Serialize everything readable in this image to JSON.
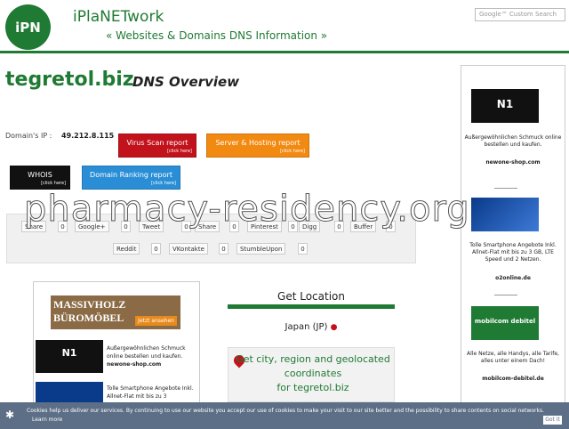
{
  "header": {
    "logo_text": "iPN",
    "brand": "iPlaNETwork",
    "tagline": "« Websites & Domains DNS Information »",
    "search_placeholder": "Google™ Custom Search"
  },
  "main": {
    "domain": "tegretol.biz",
    "subtitle": "DNS Overview",
    "ip_label": "Domain's IP :",
    "ip_value": "49.212.8.115",
    "buttons": {
      "virus": {
        "label": "Virus Scan report",
        "sub": "[click here]"
      },
      "hosting": {
        "label": "Server & Hosting report",
        "sub": "[click here]"
      },
      "whois": {
        "label": "WHOIS",
        "sub": "[click here]"
      },
      "ranking": {
        "label": "Domain Ranking report",
        "sub": "[click here]"
      }
    },
    "share": {
      "buttons": [
        {
          "label": "Share",
          "count": "0"
        },
        {
          "label": "Google+",
          "count": "0"
        },
        {
          "label": "Tweet",
          "count": "0"
        },
        {
          "label": "Share",
          "count": "0"
        },
        {
          "label": "Pinterest",
          "count": "0"
        },
        {
          "label": "Digg",
          "count": "0"
        },
        {
          "label": "Buffer",
          "count": "0"
        },
        {
          "label": "Reddit",
          "count": "0"
        },
        {
          "label": "VKontakte",
          "count": "0"
        },
        {
          "label": "StumbleUpon",
          "count": "0"
        }
      ]
    },
    "ads": {
      "massiv_line1": "MASSIVHOLZ",
      "massiv_line2": "BÜROMÖBEL",
      "massiv_cta": "Jetzt ansehen",
      "item1_logo": "N1",
      "item1_text": "Außergewöhnlichen Schmuck online bestellen und kaufen.",
      "item1_link": "newone-shop.com",
      "item2_text": "Tolle Smartphone Angebote Inkl. Allnet-Flat mit bis zu 3"
    },
    "location": {
      "title": "Get Location",
      "country": "Japan (JP)",
      "geo_line1": "Get city, region and geolocated",
      "geo_line2": "coordinates",
      "geo_line3": "for tegretol.biz"
    }
  },
  "sidebar": {
    "ad1": {
      "logo": "N1",
      "text": "Außergewöhnlichen Schmuck online bestellen und kaufen.",
      "link": "newone-shop.com"
    },
    "ad2": {
      "text": "Tolle Smartphone Angebote Inkl. Allnet-Flat mit bis zu 3 GB, LTE Speed und 2 Netzen.",
      "link": "o2online.de"
    },
    "ad3": {
      "logo": "mobilcom debitel",
      "text": "Alle Netze, alle Handys, alle Tarife, alles unter einem Dach!",
      "link": "mobilcom-debitel.de"
    }
  },
  "watermark": "pharmacy-residency.org",
  "cookie": {
    "text": "Cookies help us deliver our services. By continuing to use our website you accept our use of cookies to make your visit to our site better and the possibility to share contents on social networks.",
    "learn_more": "Learn more",
    "button": "Got it"
  },
  "colors": {
    "brand_green": "#1f7a33",
    "virus_red": "#c2121c",
    "hosting_orange": "#f28a12",
    "ranking_blue": "#2a8ed6",
    "cookie_bar": "#5d6f86"
  }
}
